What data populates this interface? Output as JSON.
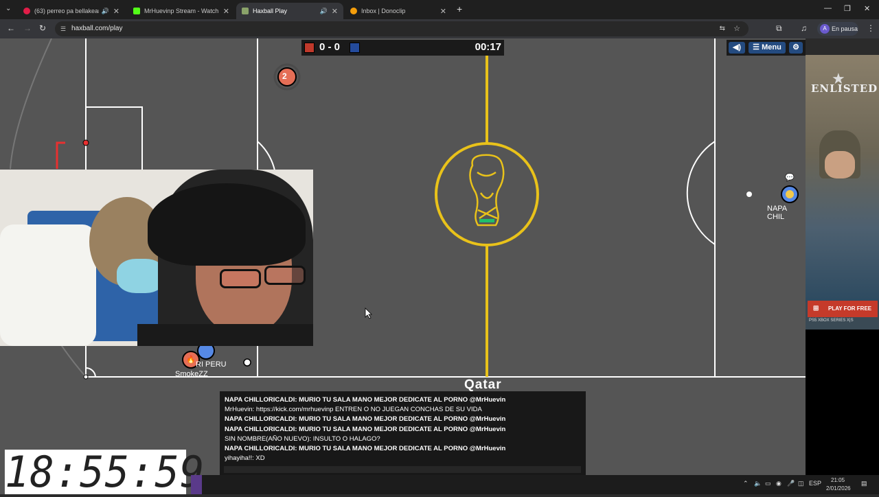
{
  "browser": {
    "tabs": [
      {
        "title": "(63) perreo pa bellakear dj",
        "favicon_color": "#e11d48"
      },
      {
        "title": "MrHuevinp Stream - Watch Live",
        "favicon_color": "#53fc18"
      },
      {
        "title": "Haxball Play",
        "favicon_color": "#8aa36a"
      },
      {
        "title": "Inbox | Donoclip",
        "favicon_color": "#f59e0b"
      }
    ],
    "new_tab_label": "+",
    "url": "haxball.com/play",
    "profile_label": "En pausa",
    "profile_initial": "A"
  },
  "game": {
    "score": "0 - 0",
    "timer": "00:17",
    "red_color": "#e56e56",
    "blue_color": "#5689e5",
    "menu_label": "Menu",
    "stadium_label": "Qatar",
    "player_number": "2",
    "players": [
      {
        "name": "NAPA CHIL",
        "team": "blue"
      },
      {
        "name": "RI PERU",
        "team": "blue"
      },
      {
        "name": "SmokeZZ",
        "team": "red"
      }
    ]
  },
  "chat": {
    "messages": [
      {
        "text": "NAPA CHILLORICALDI: MURIO TU SALA MANO MEJOR DEDICATE AL PORNO @MrHuevin",
        "bold": true
      },
      {
        "text": "MrHuevin: https://kick.com/mrhuevinp ENTREN O NO JUEGAN CONCHAS DE SU VIDA",
        "bold": false
      },
      {
        "text": "NAPA CHILLORICALDI: MURIO TU SALA MANO MEJOR DEDICATE AL PORNO @MrHuevin",
        "bold": true
      },
      {
        "text": "NAPA CHILLORICALDI: MURIO TU SALA MANO MEJOR DEDICATE AL PORNO @MrHuevin",
        "bold": true
      },
      {
        "text": "SIN NOMBRE(AÑO NUEVO): INSULTO O HALAGO?",
        "bold": false
      },
      {
        "text": "NAPA CHILLORICALDI: MURIO TU SALA MANO MEJOR DEDICATE AL PORNO @MrHuevin",
        "bold": true
      },
      {
        "text": "yihayiha!!: XD",
        "bold": false
      }
    ]
  },
  "ad": {
    "brand": "ENLISTED",
    "cta": "PLAY FOR FREE",
    "platforms": "PS5  XBOX SERIES X|S"
  },
  "overlay_clock": "18:55:59",
  "taskbar": {
    "lang": "ESP",
    "time": "21:05",
    "date": "2/01/2026"
  }
}
